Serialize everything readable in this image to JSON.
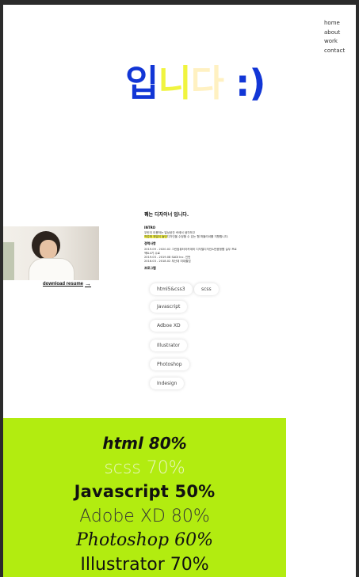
{
  "nav": {
    "items": [
      {
        "label": "home"
      },
      {
        "label": "about"
      },
      {
        "label": "work"
      },
      {
        "label": "contact"
      }
    ]
  },
  "hero": {
    "chars": [
      "입",
      "니",
      "다",
      " :)"
    ]
  },
  "colors": {
    "hero_blue": "#1236d6",
    "hero_yellow": "#f0f43f",
    "hero_cream": "#fff1c2",
    "skill_bg": "#b2ec10"
  },
  "profile": {
    "download_label": "download resume",
    "download_arrow": "→"
  },
  "resume": {
    "title": "꿰는 디자이너 입니다.",
    "intro_heading": "INTRO",
    "intro_line_1": "우린이 이용하는 일상공간 속에서 생각하고",
    "intro_line_2_highlight": "작업에 재밀이 들던",
    "intro_line_2_rest": "디자인을 수정할 수 있는 웹 퍼블리셔를 지향합니다.",
    "edu_heading": "경력사항",
    "edu_lines": [
      "2019.09 - 2020.02  그린컴퓨터아카데미 디지털디자인&반응형웹 실무 프로",
      "젝트4기 수료",
      "2019.03 - 2019.08  SADI Inc. 인턴",
      "2016.03 - 2018.02  부산대 미대졸업"
    ],
    "program_heading": "프로그램"
  },
  "skills": {
    "pills": [
      "html5&css3",
      "scss",
      "Javascript",
      "Adboe XD",
      "Illustrator",
      "Photoshop",
      "Indesign"
    ]
  },
  "skill_percent": {
    "items": [
      "html 80%",
      "scss 70%",
      "Javascript 50%",
      "Adobe XD 80%",
      "Photoshop 60%",
      "Illustrator 70%"
    ]
  }
}
